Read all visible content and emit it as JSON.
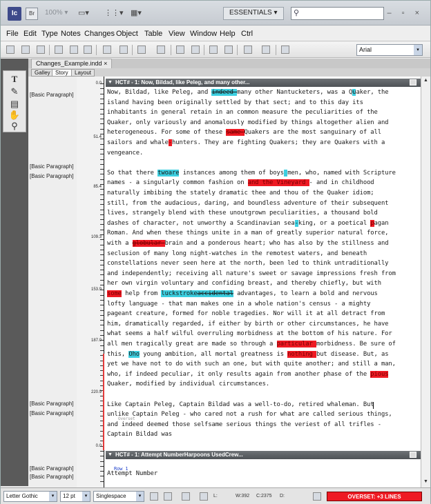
{
  "app": {
    "icon": "Ic",
    "bridge": "Br",
    "zoom": "100%",
    "workspace": "ESSENTIALS",
    "window_controls": "– ▫ ×"
  },
  "menu": [
    "File",
    "Edit",
    "Type",
    "Notes",
    "Changes",
    "Object",
    "Table",
    "View",
    "Window",
    "Help",
    "Ctrl"
  ],
  "toolbar": {
    "font": "Arial"
  },
  "document": {
    "name": "Changes_Example.indd",
    "tabs": [
      "Galley",
      "Story",
      "Layout"
    ]
  },
  "paragraph_styles": [
    "[Basic Paragraph]",
    "[Basic Paragraph]",
    "[Basic Paragraph]",
    "[Basic Paragraph]",
    "[Basic Paragraph]",
    "[Basic Paragraph]",
    "[Basic Paragraph]"
  ],
  "ruler": [
    "0.0",
    "51.4",
    "85.4",
    "109.3",
    "153.9",
    "187.0",
    "220.9",
    "0.0"
  ],
  "story1": {
    "header": "HCT# - 1: Now, Bildad, like Peleg, and many other..."
  },
  "story2": {
    "header": "HCT# - 1: Attempt NumberHarpoons UsedCrew..."
  },
  "lines": [
    [
      {
        "t": "Now, Bildad, like Peleg, and "
      },
      {
        "t": "indeed ",
        "c": "cy st"
      },
      {
        "t": "many other Nantucketers, was a Q"
      },
      {
        "t": "u",
        "c": "cy"
      },
      {
        "t": "aker, the"
      }
    ],
    [
      {
        "t": "island having been originally settled by that sect; and to this day its"
      }
    ],
    [
      {
        "t": "inhabitants in general retain in an common measure the peculiarities of the"
      }
    ],
    [
      {
        "t": "Quaker, only variously and anomalously modified by things altogether alien and"
      }
    ],
    [
      {
        "t": "heterogeneous. For some of these "
      },
      {
        "t": "same ",
        "c": "rd st"
      },
      {
        "t": "Quakers are the most sanguinary of all"
      }
    ],
    [
      {
        "t": "sailors and whale"
      },
      {
        "t": "-",
        "c": "rd"
      },
      {
        "t": "hunters. They are fighting Quakers; they are Quakers with a"
      }
    ],
    [
      {
        "t": "vengeance."
      }
    ],
    [
      {
        "t": ""
      }
    ],
    [
      {
        "t": "So that there "
      },
      {
        "t": "twoare",
        "c": "cy"
      },
      {
        "t": " instances among them of boys"
      },
      {
        "t": " ",
        "c": "cy"
      },
      {
        "t": "men, who, named with Scripture"
      }
    ],
    [
      {
        "t": "names - a singularly common fashion on "
      },
      {
        "t": "  and the Vineyard ",
        "c": "rd"
      },
      {
        "t": " - and in childhood"
      }
    ],
    [
      {
        "t": "naturally imbibing the stately dramatic thee and thou of the Quaker idiom;"
      }
    ],
    [
      {
        "t": "still, from the audacious, daring, and boundless adventure of their subsequent"
      }
    ],
    [
      {
        "t": "lives, strangely blend with these unoutgrown peculiarities, a thousand bold"
      }
    ],
    [
      {
        "t": "dashes of character, not unworthy a Scandinavian sea"
      },
      {
        "t": "-",
        "c": "cy"
      },
      {
        "t": "king, or a poetical "
      },
      {
        "t": "p",
        "c": "rd"
      },
      {
        "t": "agan"
      }
    ],
    [
      {
        "t": "Roman. And when these things unite in a man of greatly superior natural force,"
      }
    ],
    [
      {
        "t": "with a "
      },
      {
        "t": "globular ",
        "c": "rd st"
      },
      {
        "t": "brain and a ponderous heart; who has also by the stillness and"
      }
    ],
    [
      {
        "t": "seclusion of many long night-watches in the remotest waters, and beneath"
      }
    ],
    [
      {
        "t": "constellations never seen here at the north, been led to think untraditionally"
      }
    ],
    [
      {
        "t": "and independently; receiving all nature's sweet or savage impressions fresh from"
      }
    ],
    [
      {
        "t": "her own virgin voluntary and confiding breast, and thereby chiefly, but with"
      }
    ],
    [
      {
        "t": "some",
        "c": "rd"
      },
      {
        "t": " help from "
      },
      {
        "t": "luckstroke",
        "c": "cy"
      },
      {
        "t": "accidental",
        "c": "cy st"
      },
      {
        "t": " advantages, to learn a bold and nervous"
      }
    ],
    [
      {
        "t": "lofty language - that man makes one in a whole nation's census - a mighty"
      }
    ],
    [
      {
        "t": "pageant creature, formed for noble tragedies. Nor will it at all detract from"
      }
    ],
    [
      {
        "t": "him, dramatically regarded, if either by birth or other circumstances, he have"
      }
    ],
    [
      {
        "t": "what seems a half wilful overruling morbidness at the bottom of his nature. For"
      }
    ],
    [
      {
        "t": "all men tragically great are made so through a "
      },
      {
        "t": "particular ",
        "c": "rd"
      },
      {
        "t": "morbidness. Be sure of"
      }
    ],
    [
      {
        "t": "this, "
      },
      {
        "t": "Oho",
        "c": "cy"
      },
      {
        "t": " young ambition, all mortal greatness is "
      },
      {
        "t": "nothing ",
        "c": "rd"
      },
      {
        "t": "but disease. But, as"
      }
    ],
    [
      {
        "t": "yet we have not to do with such an one, but with quite another; and still a man,"
      }
    ],
    [
      {
        "t": "who, if indeed peculiar, it only results again from another phase of the "
      },
      {
        "t": "pious",
        "c": "rd"
      }
    ],
    [
      {
        "t": "Quaker, modified by individual circumstances."
      }
    ],
    [
      {
        "t": ""
      }
    ],
    [
      {
        "t": "Like Captain Peleg, Captain Bildad was a well-to-do, retired whaleman. But"
      }
    ],
    [
      {
        "t": "unlike Captain Peleg - who cared not a rush for what are called serious things,"
      }
    ],
    [
      {
        "t": "and indeed deemed those selfsame serious things the veriest of all trifles -"
      }
    ],
    [
      {
        "t": "Captain Bildad was"
      }
    ]
  ],
  "story2_lines": [
    "Attempt Number"
  ],
  "row_label": "Row 1",
  "overset_label": "Overset",
  "status": {
    "font": "Letter Gothic",
    "size": "12 pt",
    "spacing": "Singlespace",
    "lines": "L:",
    "words": "W:392",
    "chars": "C:2375",
    "depth": "D:",
    "overset": "OVERSET: +3 LINES"
  }
}
